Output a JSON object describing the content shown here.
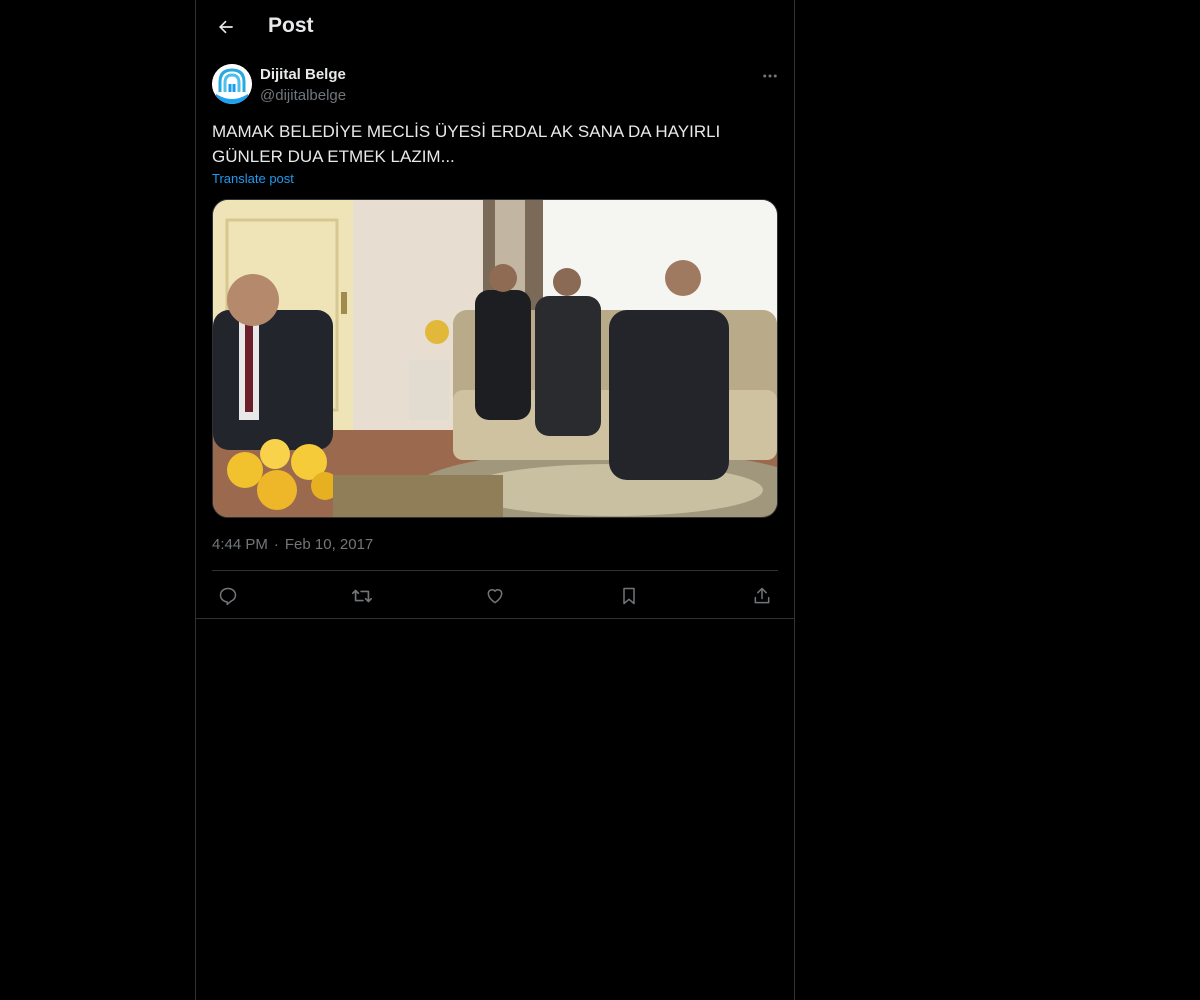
{
  "header": {
    "title": "Post",
    "back_icon": "arrow-left-icon"
  },
  "author": {
    "display_name": "Dijital Belge",
    "handle": "@dijitalbelge",
    "avatar_icon": "dijital-belge-logo-icon"
  },
  "post": {
    "text": "MAMAK BELEDİYE MECLİS ÜYESİ ERDAL AK SANA DA HAYIRLI GÜNLER DUA ETMEK LAZIM...",
    "translate_label": "Translate post",
    "time": "4:44 PM",
    "separator": "·",
    "date": "Feb 10, 2017",
    "media_icon": "photo-icon"
  },
  "actions": {
    "reply_icon": "reply-icon",
    "repost_icon": "repost-icon",
    "like_icon": "heart-icon",
    "bookmark_icon": "bookmark-icon",
    "share_icon": "share-icon",
    "more_icon": "more-dots-icon"
  },
  "colors": {
    "background": "#000000",
    "text": "#e7e9ea",
    "muted": "#71767b",
    "accent": "#1d9bf0",
    "border": "#2f3336"
  }
}
